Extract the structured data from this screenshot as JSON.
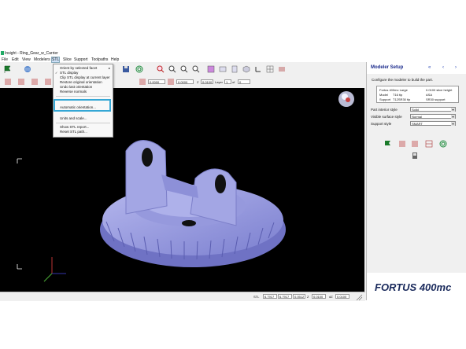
{
  "window": {
    "title": "Insight - Ring_Gear_w_Carrier"
  },
  "menubar": [
    "File",
    "Edit",
    "View",
    "Modelers",
    "STL",
    "Slice",
    "Support",
    "Toolpaths",
    "Help"
  ],
  "stl_menu": {
    "items": [
      "Orient by selected facet",
      "STL display",
      "Clip STL display at current layer",
      "Restore original orientation",
      "Undo last orientation",
      "Reverse normals",
      "Automatic orientation...",
      "Units and scale...",
      "Show STL report...",
      "Reset STL path..."
    ],
    "highlighted": "Automatic orientation..."
  },
  "toolbar": {
    "field_a": "0.0000",
    "field_b": "0.0000",
    "z_label": "Z",
    "z_value": "0.0100",
    "layer_label": "Layer",
    "layer_value": "1",
    "of_label": "of",
    "of_value": "0"
  },
  "panel": {
    "title": "Modeler Setup",
    "description": "Configure the modeler to build the part.",
    "info": {
      "modeler": "Fortus 400mc Large",
      "model_label": "Model",
      "model_value": "T16 tip",
      "support_label": "Support",
      "support_value": "T12SR30 tip",
      "slice": "0.0100 slice height",
      "model_material": "ASA",
      "support_material": "SR30 support"
    },
    "settings": [
      {
        "label": "Part interior style",
        "value": "Solid"
      },
      {
        "label": "Visible surface style",
        "value": "Normal"
      },
      {
        "label": "Support style",
        "value": "SMART"
      }
    ],
    "logo": "FORTUS 400mc"
  },
  "statusbar": {
    "stl": "STL",
    "x": "6.7917",
    "y": "6.7917",
    "z1": "0.0512",
    "z_label": "Z",
    "z2": "0.0100",
    "dz_label": "dZ",
    "dz": "0.0100"
  },
  "colors": {
    "viewport": "#000000",
    "model": "#8c8fd6",
    "highlight": "#35a7d5",
    "panel_title": "#1a2a8c"
  }
}
